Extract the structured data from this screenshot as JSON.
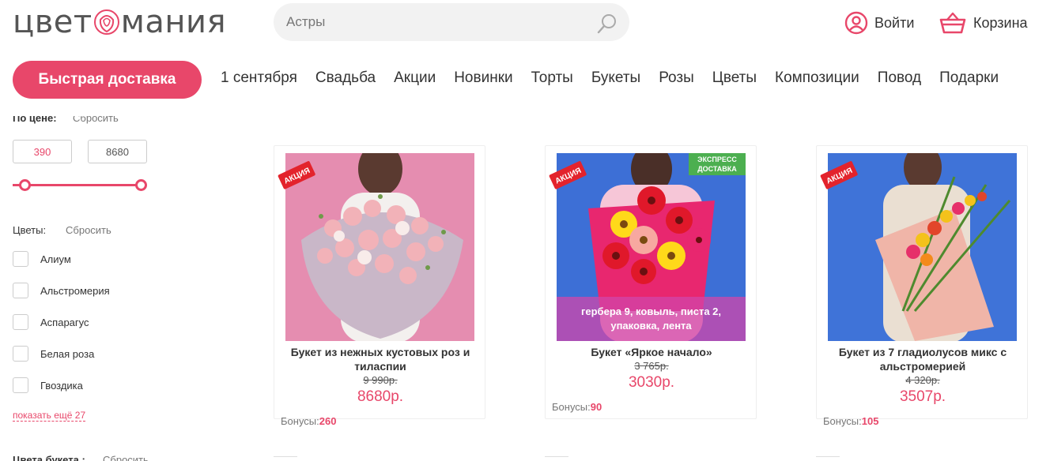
{
  "header": {
    "logo_left": "цвет",
    "logo_right": "мания",
    "search_value": "Астры",
    "login_label": "Войти",
    "cart_label": "Корзина"
  },
  "nav": {
    "fast_delivery": "Быстрая доставка",
    "items": [
      "1 сентября",
      "Свадьба",
      "Акции",
      "Новинки",
      "Торты",
      "Букеты",
      "Розы",
      "Цветы",
      "Композиции",
      "Повод",
      "Подарки"
    ]
  },
  "filters": {
    "price_title": "По цене:",
    "price_reset": "Сбросить",
    "price_min": "390",
    "price_max": "8680",
    "flowers_title": "Цветы:",
    "flowers_reset": "Сбросить",
    "flowers": [
      "Алиум",
      "Альстромерия",
      "Аспарагус",
      "Белая роза",
      "Гвоздика"
    ],
    "show_more": "показать ещё 27",
    "bouquet_color_title": "Цвета букета :",
    "bouquet_color_reset": "Сбросить"
  },
  "products": [
    {
      "name": "Букет из нежных кустовых роз и тиласпии",
      "old_price": "9 990р.",
      "price": "8680р.",
      "bonus_label": "Бонусы:",
      "bonus_value": "260",
      "badge": "АКЦИЯ"
    },
    {
      "name": "Букет «Яркое начало»",
      "old_price": "3 765р.",
      "price": "3030р.",
      "bonus_label": "Бонусы:",
      "bonus_value": "90",
      "badge": "АКЦИЯ",
      "express": "ЭКСПРЕСС ДОСТАВКА",
      "composition": "гербера 9, ковыль, писта 2, упаковка, лента"
    },
    {
      "name": "Букет из 7 гладиолусов микс с альстромерией",
      "old_price": "4 320р.",
      "price": "3507р.",
      "bonus_label": "Бонусы:",
      "bonus_value": "105",
      "badge": "АКЦИЯ"
    }
  ],
  "colors": {
    "accent": "#e8476a",
    "express": "#4caf50"
  }
}
